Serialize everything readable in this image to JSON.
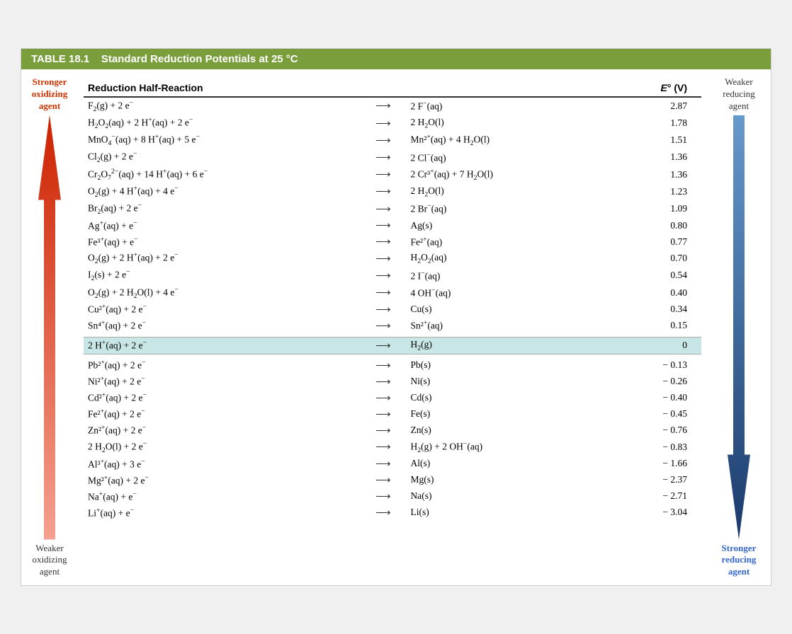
{
  "title_bar": {
    "table_num": "TABLE 18.1",
    "title": "Standard Reduction Potentials at 25 °C"
  },
  "header": {
    "col1": "Reduction Half-Reaction",
    "col2": "",
    "col3": "",
    "col4": "E° (V)"
  },
  "left_labels": {
    "top": [
      "Stronger",
      "oxidizing",
      "agent"
    ],
    "bottom": [
      "Weaker",
      "oxidizing",
      "agent"
    ]
  },
  "right_labels": {
    "top": [
      "Weaker",
      "reducing",
      "agent"
    ],
    "bottom": [
      "Stronger",
      "reducing",
      "agent"
    ]
  },
  "rows_above": [
    {
      "left": "F₂(g) + 2 e⁻",
      "right": "2 F⁻(aq)",
      "ev": "2.87"
    },
    {
      "left": "H₂O₂(aq) + 2 H⁺(aq) + 2 e⁻",
      "right": "2 H₂O(l)",
      "ev": "1.78"
    },
    {
      "left": "MnO₄⁻(aq) + 8 H⁺(aq) + 5 e⁻",
      "right": "Mn²⁺(aq) + 4 H₂O(l)",
      "ev": "1.51"
    },
    {
      "left": "Cl₂(g) + 2 e⁻",
      "right": "2 Cl⁻(aq)",
      "ev": "1.36"
    },
    {
      "left": "Cr₂O₇²⁻(aq) + 14 H⁺(aq) + 6 e⁻",
      "right": "2 Cr³⁺(aq) + 7 H₂O(l)",
      "ev": "1.36"
    },
    {
      "left": "O₂(g) + 4 H⁺(aq) + 4 e⁻",
      "right": "2 H₂O(l)",
      "ev": "1.23"
    },
    {
      "left": "Br₂(aq) + 2 e⁻",
      "right": "2 Br⁻(aq)",
      "ev": "1.09"
    },
    {
      "left": "Ag⁺(aq) + e⁻",
      "right": "Ag(s)",
      "ev": "0.80"
    },
    {
      "left": "Fe³⁺(aq) + e⁻",
      "right": "Fe²⁺(aq)",
      "ev": "0.77"
    },
    {
      "left": "O₂(g) + 2 H⁺(aq) + 2 e⁻",
      "right": "H₂O₂(aq)",
      "ev": "0.70"
    },
    {
      "left": "I₂(s) + 2 e⁻",
      "right": "2 I⁻(aq)",
      "ev": "0.54"
    },
    {
      "left": "O₂(g) + 2 H₂O(l) + 4 e⁻",
      "right": "4 OH⁻(aq)",
      "ev": "0.40"
    },
    {
      "left": "Cu²⁺(aq) + 2 e⁻",
      "right": "Cu(s)",
      "ev": "0.34"
    },
    {
      "left": "Sn⁴⁺(aq) + 2 e⁻",
      "right": "Sn²⁺(aq)",
      "ev": "0.15"
    }
  ],
  "highlighted_row": {
    "left": "2 H⁺(aq) + 2 e⁻",
    "right": "H₂(g)",
    "ev": "0"
  },
  "rows_below": [
    {
      "left": "Pb²⁺(aq) + 2 e⁻",
      "right": "Pb(s)",
      "ev": "− 0.13"
    },
    {
      "left": "Ni²⁺(aq) + 2 e⁻",
      "right": "Ni(s)",
      "ev": "− 0.26"
    },
    {
      "left": "Cd²⁺(aq) + 2 e⁻",
      "right": "Cd(s)",
      "ev": "− 0.40"
    },
    {
      "left": "Fe²⁺(aq) + 2 e⁻",
      "right": "Fe(s)",
      "ev": "− 0.45"
    },
    {
      "left": "Zn²⁺(aq) + 2 e⁻",
      "right": "Zn(s)",
      "ev": "− 0.76"
    },
    {
      "left": "2 H₂O(l) + 2 e⁻",
      "right": "H₂(g) + 2 OH⁻(aq)",
      "ev": "− 0.83"
    },
    {
      "left": "Al³⁺(aq) + 3 e⁻",
      "right": "Al(s)",
      "ev": "− 1.66"
    },
    {
      "left": "Mg²⁺(aq) + 2 e⁻",
      "right": "Mg(s)",
      "ev": "− 2.37"
    },
    {
      "left": "Na⁺(aq) + e⁻",
      "right": "Na(s)",
      "ev": "− 2.71"
    },
    {
      "left": "Li⁺(aq) + e⁻",
      "right": "Li(s)",
      "ev": "− 3.04"
    }
  ]
}
